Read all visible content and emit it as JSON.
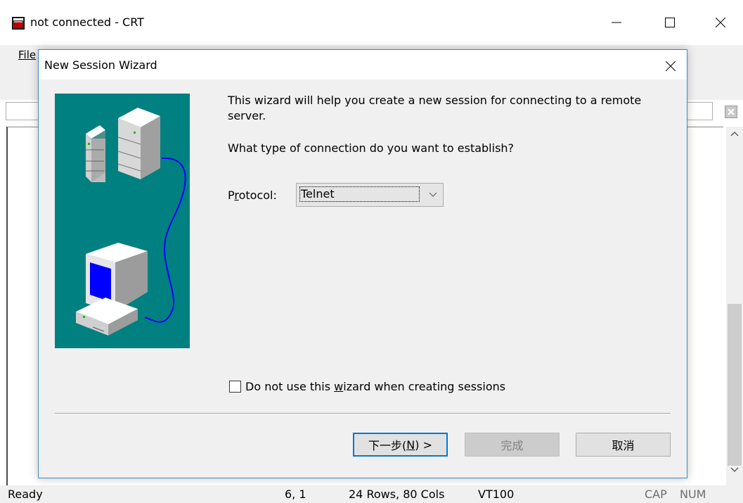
{
  "window": {
    "title": "not connected - CRT",
    "menu_file": "File"
  },
  "dialog": {
    "title": "New Session Wizard",
    "intro": "This wizard will help you create a new session for connecting to a remote server.",
    "question": "What type of connection do you want to establish?",
    "protocol_label_pre": "P",
    "protocol_label_accel": "r",
    "protocol_label_post": "otocol:",
    "protocol_value": "Telnet",
    "checkbox_label_pre": "Do not use this ",
    "checkbox_label_accel": "w",
    "checkbox_label_post": "izard when creating sessions",
    "checkbox_checked": false,
    "next_label_pre": "下一步(",
    "next_label_accel": "N",
    "next_label_post": ") >",
    "finish_label": "完成",
    "cancel_label": "取消"
  },
  "statusbar": {
    "ready": "Ready",
    "cursor_pos": "6,  1",
    "size": "24 Rows,  80 Cols",
    "terminal": "VT100",
    "cap": "CAP",
    "num": "NUM"
  },
  "colors": {
    "illustration_bg": "#008080",
    "accent": "#0078d7",
    "dialog_border": "#3c8ad2"
  }
}
